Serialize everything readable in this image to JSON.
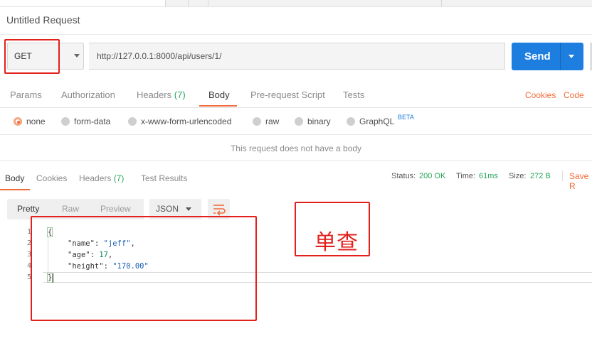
{
  "request": {
    "title": "Untitled Request",
    "method": "GET",
    "url": "http://127.0.0.1:8000/api/users/1/",
    "send_label": "Send"
  },
  "request_tabs": {
    "params": "Params",
    "authorization": "Authorization",
    "headers": "Headers",
    "headers_count": "(7)",
    "body": "Body",
    "prerequest": "Pre-request Script",
    "tests": "Tests",
    "cookies": "Cookies",
    "code": "Code"
  },
  "body_modes": {
    "none": "none",
    "form_data": "form-data",
    "urlencoded": "x-www-form-urlencoded",
    "raw": "raw",
    "binary": "binary",
    "graphql": "GraphQL",
    "beta": "BETA",
    "selected": "none"
  },
  "no_body_message": "This request does not have a body",
  "response_tabs": {
    "body": "Body",
    "cookies": "Cookies",
    "headers": "Headers",
    "headers_count": "(7)",
    "test_results": "Test Results"
  },
  "response_meta": {
    "status_label": "Status:",
    "status_value": "200 OK",
    "time_label": "Time:",
    "time_value": "61ms",
    "size_label": "Size:",
    "size_value": "272 B",
    "save_label": "Save R"
  },
  "view": {
    "pretty": "Pretty",
    "raw": "Raw",
    "preview": "Preview",
    "format": "JSON"
  },
  "response_body": {
    "line_numbers": [
      "1",
      "2",
      "3",
      "4",
      "5"
    ],
    "open_brace": "{",
    "close_brace": "}",
    "name_key": "\"name\"",
    "name_value": "\"jeff\"",
    "age_key": "\"age\"",
    "age_value": "17",
    "height_key": "\"height\"",
    "height_value": "\"170.00\""
  },
  "annotation": {
    "label": "单查",
    "color": "#e2211c"
  },
  "colors": {
    "accent_orange": "#f26b3a",
    "send_blue": "#1d7ee0",
    "status_green": "#26a65b"
  }
}
